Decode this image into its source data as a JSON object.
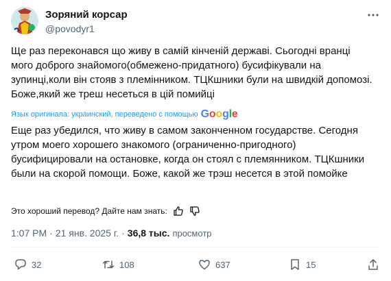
{
  "author": {
    "display_name": "Зоряний корсар",
    "handle": "@povodyr1",
    "avatar_icon": "avatar-illustration"
  },
  "tweet": {
    "original_text": "Ще раз переконався що живу в самій кінченій державі. Сьогодні вранці мого доброго знайомого(обмежено-придатного) бусифікували на зупинці,коли він стояв з племінником. ТЦКшники були на швидкій допомозі. Боже,який же треш несеться в цій помийці",
    "translation_note": "Язык оригинала: украинский, переведено с помощью",
    "translation_provider": "Google",
    "translated_text": "Еще раз убедился, что живу в самом законченном государстве. Сегодня утром моего хорошего знакомого (ограниченно-пригодного) бусифицировали на остановке, когда он стоял с племянником. ТЦКшники были на скорой помощи. Боже, какой же трэш несется в этой помойке",
    "feedback_prompt": "Это хороший перевод? Дайте нам знать:",
    "time": "1:07 PM",
    "dot": "·",
    "date": "21 янв. 2025 г.",
    "views_count": "36,8 тыс.",
    "views_label": "просмотр"
  },
  "actions": {
    "replies": "32",
    "reposts": "108",
    "likes": "637",
    "bookmarks": "15"
  },
  "colors": {
    "text": "#0f1419",
    "secondary": "#536471",
    "link": "#1d9bf0",
    "divider": "#eff3f4"
  }
}
